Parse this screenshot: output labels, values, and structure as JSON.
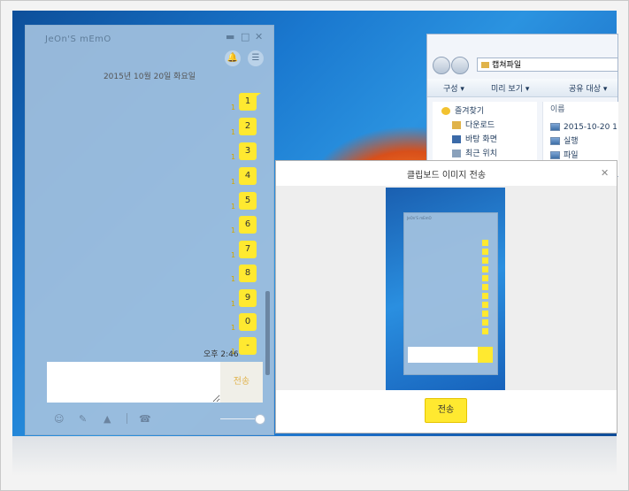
{
  "memo": {
    "title": "JeOn'S mEmO",
    "date": "2015년 10월 20일 화요일",
    "messages": [
      "1",
      "2",
      "3",
      "4",
      "5",
      "6",
      "7",
      "8",
      "9",
      "0",
      "-"
    ],
    "unread": "1",
    "time": "오후 2:46",
    "input": {
      "value": "",
      "placeholder": ""
    },
    "send_label": "전송",
    "controls": {
      "minimize": "▬",
      "maximize": "□",
      "close": "✕",
      "bell": "🔔",
      "menu": "☰"
    },
    "toolbar_icons": [
      "smile-icon",
      "attach-icon",
      "image-icon",
      "phone-icon"
    ]
  },
  "explorer": {
    "address": "캡쳐파일",
    "toolbar": [
      "구성 ▾",
      "미리 보기 ▾",
      "공유 대상 ▾"
    ],
    "tree": [
      "즐겨찾기",
      "다운로드",
      "바탕 화면",
      "최근 위치"
    ],
    "files_header": "이름",
    "files": [
      "2015-10-20 1",
      "실행",
      "파일"
    ]
  },
  "dialog": {
    "title": "클립보드 이미지 전송",
    "close": "✕",
    "send_label": "전송",
    "preview_title": "JeOn'S mEmO"
  },
  "colors": {
    "accent": "#ffe930",
    "memo_bg": "#a0c0de"
  }
}
